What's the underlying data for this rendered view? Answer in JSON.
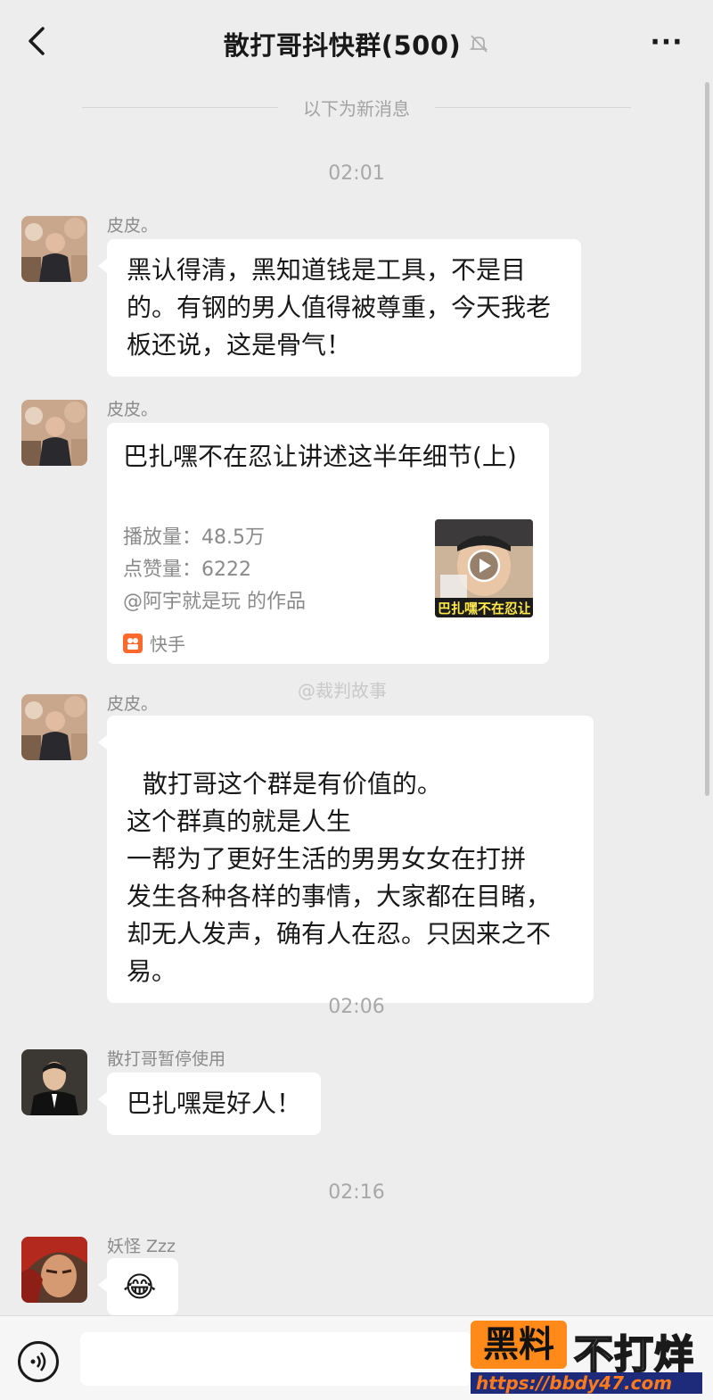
{
  "header": {
    "title": "散打哥抖快群(500)",
    "more": "···"
  },
  "divider": "以下为新消息",
  "messages": [
    {
      "time": "02:01",
      "sender": "皮皮。",
      "text": "黑认得清，黑知道钱是工具，不是目的。有钢的男人值得被尊重，今天我老板还说，这是骨气！"
    },
    {
      "sender": "皮皮。",
      "card": {
        "title": "巴扎嘿不在忍让讲述这半年细节(上)",
        "views": "播放量：48.5万",
        "likes": "点赞量：6222",
        "author": "@阿宇就是玩 的作品",
        "thumb_caption": "巴扎嘿不在忍让",
        "source": "快手"
      }
    },
    {
      "sender": "皮皮。",
      "text": "散打哥这个群是有价值的。\n这个群真的就是人生\n一帮为了更好生活的男男女女在打拼\n发生各种各样的事情，大家都在目睹，却无人发声，确有人在忍。只因来之不易。"
    },
    {
      "time": "02:06",
      "sender": "散打哥暂停使用",
      "text": "巴扎嘿是好人！"
    },
    {
      "time": "02:16",
      "sender": "妖怪 Zzz",
      "emoji": "😂"
    }
  ],
  "watermark": "@裁判故事",
  "brand": {
    "box": "黑料",
    "text": "不打烊",
    "url": "https://bbdy47.com"
  },
  "colors": {
    "background": "#ededed",
    "bubble": "#ffffff",
    "accent": "#ff8a1a"
  },
  "icons": [
    "back-icon",
    "mute-bell-icon",
    "more-icon",
    "play-icon",
    "kuaishou-icon",
    "voice-icon"
  ]
}
